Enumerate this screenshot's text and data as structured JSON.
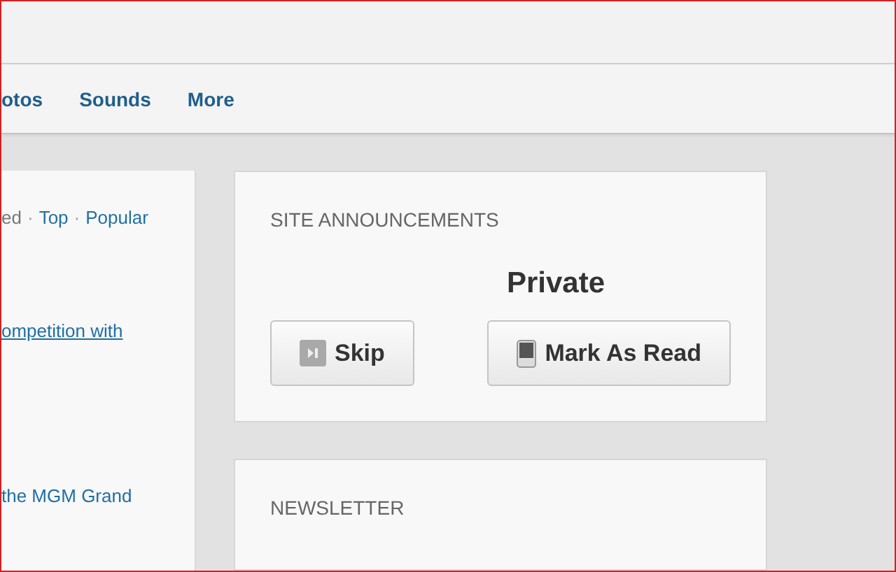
{
  "nav": {
    "items": [
      "otos",
      "Sounds",
      "More"
    ]
  },
  "left_panel": {
    "separator": "·",
    "filters": [
      {
        "label": "ed",
        "selected": true
      },
      {
        "label": "Top",
        "selected": false
      },
      {
        "label": "Popular",
        "selected": false
      }
    ],
    "links": [
      "ompetition with",
      "the MGM Grand"
    ]
  },
  "announcements": {
    "title": "SITE ANNOUNCEMENTS",
    "heading": "Private",
    "buttons": [
      {
        "label": "Skip",
        "kind": "skip"
      },
      {
        "label": "Mark As Read",
        "kind": "read"
      }
    ]
  },
  "newsletter": {
    "title": "NEWSLETTER"
  }
}
